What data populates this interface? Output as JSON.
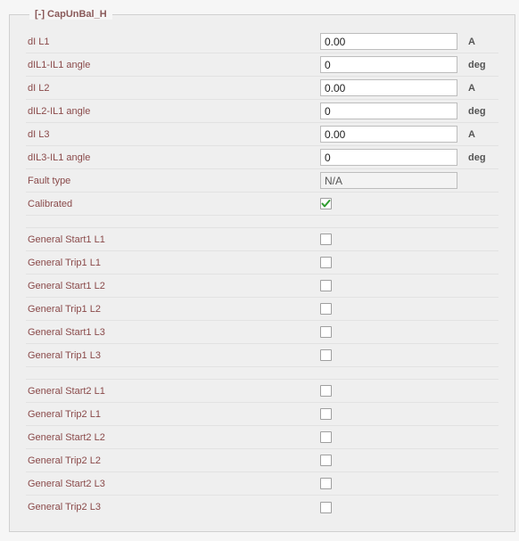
{
  "legend": "[-] CapUnBal_H",
  "rows_top": [
    {
      "id": "diL1",
      "label": "dI L1",
      "value": "0.00",
      "unit": "A"
    },
    {
      "id": "diL1IL1ang",
      "label": "dIL1-IL1 angle",
      "value": "0",
      "unit": "deg"
    },
    {
      "id": "diL2",
      "label": "dI L2",
      "value": "0.00",
      "unit": "A"
    },
    {
      "id": "diL2IL1ang",
      "label": "dIL2-IL1 angle",
      "value": "0",
      "unit": "deg"
    },
    {
      "id": "diL3",
      "label": "dI L3",
      "value": "0.00",
      "unit": "A"
    },
    {
      "id": "diL3IL1ang",
      "label": "dIL3-IL1 angle",
      "value": "0",
      "unit": "deg"
    }
  ],
  "fault_type": {
    "label": "Fault type",
    "value": "N/A"
  },
  "calibrated": {
    "label": "Calibrated",
    "checked": true
  },
  "group1": [
    {
      "id": "gs1l1",
      "label": "General Start1 L1",
      "checked": false
    },
    {
      "id": "gt1l1",
      "label": "General Trip1 L1",
      "checked": false
    },
    {
      "id": "gs1l2",
      "label": "General Start1 L2",
      "checked": false
    },
    {
      "id": "gt1l2",
      "label": "General Trip1 L2",
      "checked": false
    },
    {
      "id": "gs1l3",
      "label": "General Start1 L3",
      "checked": false
    },
    {
      "id": "gt1l3",
      "label": "General Trip1 L3",
      "checked": false
    }
  ],
  "group2": [
    {
      "id": "gs2l1",
      "label": "General Start2 L1",
      "checked": false
    },
    {
      "id": "gt2l1",
      "label": "General Trip2 L1",
      "checked": false
    },
    {
      "id": "gs2l2",
      "label": "General Start2 L2",
      "checked": false
    },
    {
      "id": "gt2l2",
      "label": "General Trip2 L2",
      "checked": false
    },
    {
      "id": "gs2l3",
      "label": "General Start2 L3",
      "checked": false
    },
    {
      "id": "gt2l3",
      "label": "General Trip2 L3",
      "checked": false
    }
  ]
}
